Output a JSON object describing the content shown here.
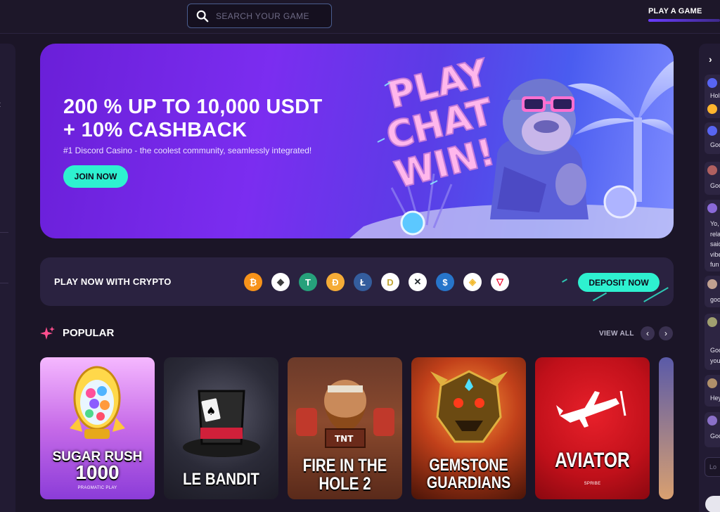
{
  "header": {
    "search_placeholder": "SEARCH YOUR GAME",
    "play_tab": "PLAY A GAME"
  },
  "hero": {
    "headline_line1": "200 % UP TO 10,000 USDT",
    "headline_line2": "+ 10% CASHBACK",
    "subtitle": "#1 Discord Casino - the coolest community, seamlessly integrated!",
    "cta": "JOIN NOW",
    "art_text": [
      "PLAY",
      "CHAT",
      "WIN!"
    ]
  },
  "crypto": {
    "label": "PLAY NOW WITH CRYPTO",
    "deposit": "DEPOSIT NOW",
    "coins": [
      {
        "name": "bitcoin-icon",
        "glyph": "₿",
        "color": "#f7931a"
      },
      {
        "name": "ethereum-icon",
        "glyph": "◆",
        "color": "#ffffff"
      },
      {
        "name": "tether-icon",
        "glyph": "T",
        "color": "#26a17b"
      },
      {
        "name": "dai-icon",
        "glyph": "Ð",
        "color": "#f5ac37"
      },
      {
        "name": "litecoin-icon",
        "glyph": "Ł",
        "color": "#345d9d"
      },
      {
        "name": "dogecoin-icon",
        "glyph": "D",
        "color": "#c2a633"
      },
      {
        "name": "xrp-icon",
        "glyph": "✕",
        "color": "#23292f"
      },
      {
        "name": "usdc-icon",
        "glyph": "$",
        "color": "#2775ca"
      },
      {
        "name": "bnb-icon",
        "glyph": "◈",
        "color": "#f3ba2f"
      },
      {
        "name": "tron-icon",
        "glyph": "▽",
        "color": "#ffffff"
      }
    ]
  },
  "popular": {
    "title": "POPULAR",
    "view_all": "VIEW ALL",
    "prev": "‹",
    "next": "›",
    "games": [
      {
        "title_line1": "SUGAR RUSH",
        "title_line2": "1000",
        "provider": "PRAGMATIC PLAY"
      },
      {
        "title_line1": "LE BANDIT",
        "title_line2": "",
        "provider": ""
      },
      {
        "title_line1": "FIRE IN THE",
        "title_line2": "HOLE 2",
        "provider": ""
      },
      {
        "title_line1": "GEMSTONE",
        "title_line2": "GUARDIANS",
        "provider": ""
      },
      {
        "title_line1": "AVIATOR",
        "title_line2": "",
        "provider": "SPRIBE"
      }
    ]
  },
  "chat": {
    "messages": [
      {
        "text": "Hol"
      },
      {
        "text": "Goo"
      },
      {
        "text": "Goo"
      },
      {
        "text": "Yo,"
      },
      {
        "text": "rela"
      },
      {
        "text": "said"
      },
      {
        "text": "vibe"
      },
      {
        "text": "fun"
      },
      {
        "text": "goo"
      },
      {
        "text": "Goo"
      },
      {
        "text": "you"
      },
      {
        "text": "Hey"
      },
      {
        "text": "Goo"
      }
    ],
    "input_placeholder": "Lo"
  }
}
